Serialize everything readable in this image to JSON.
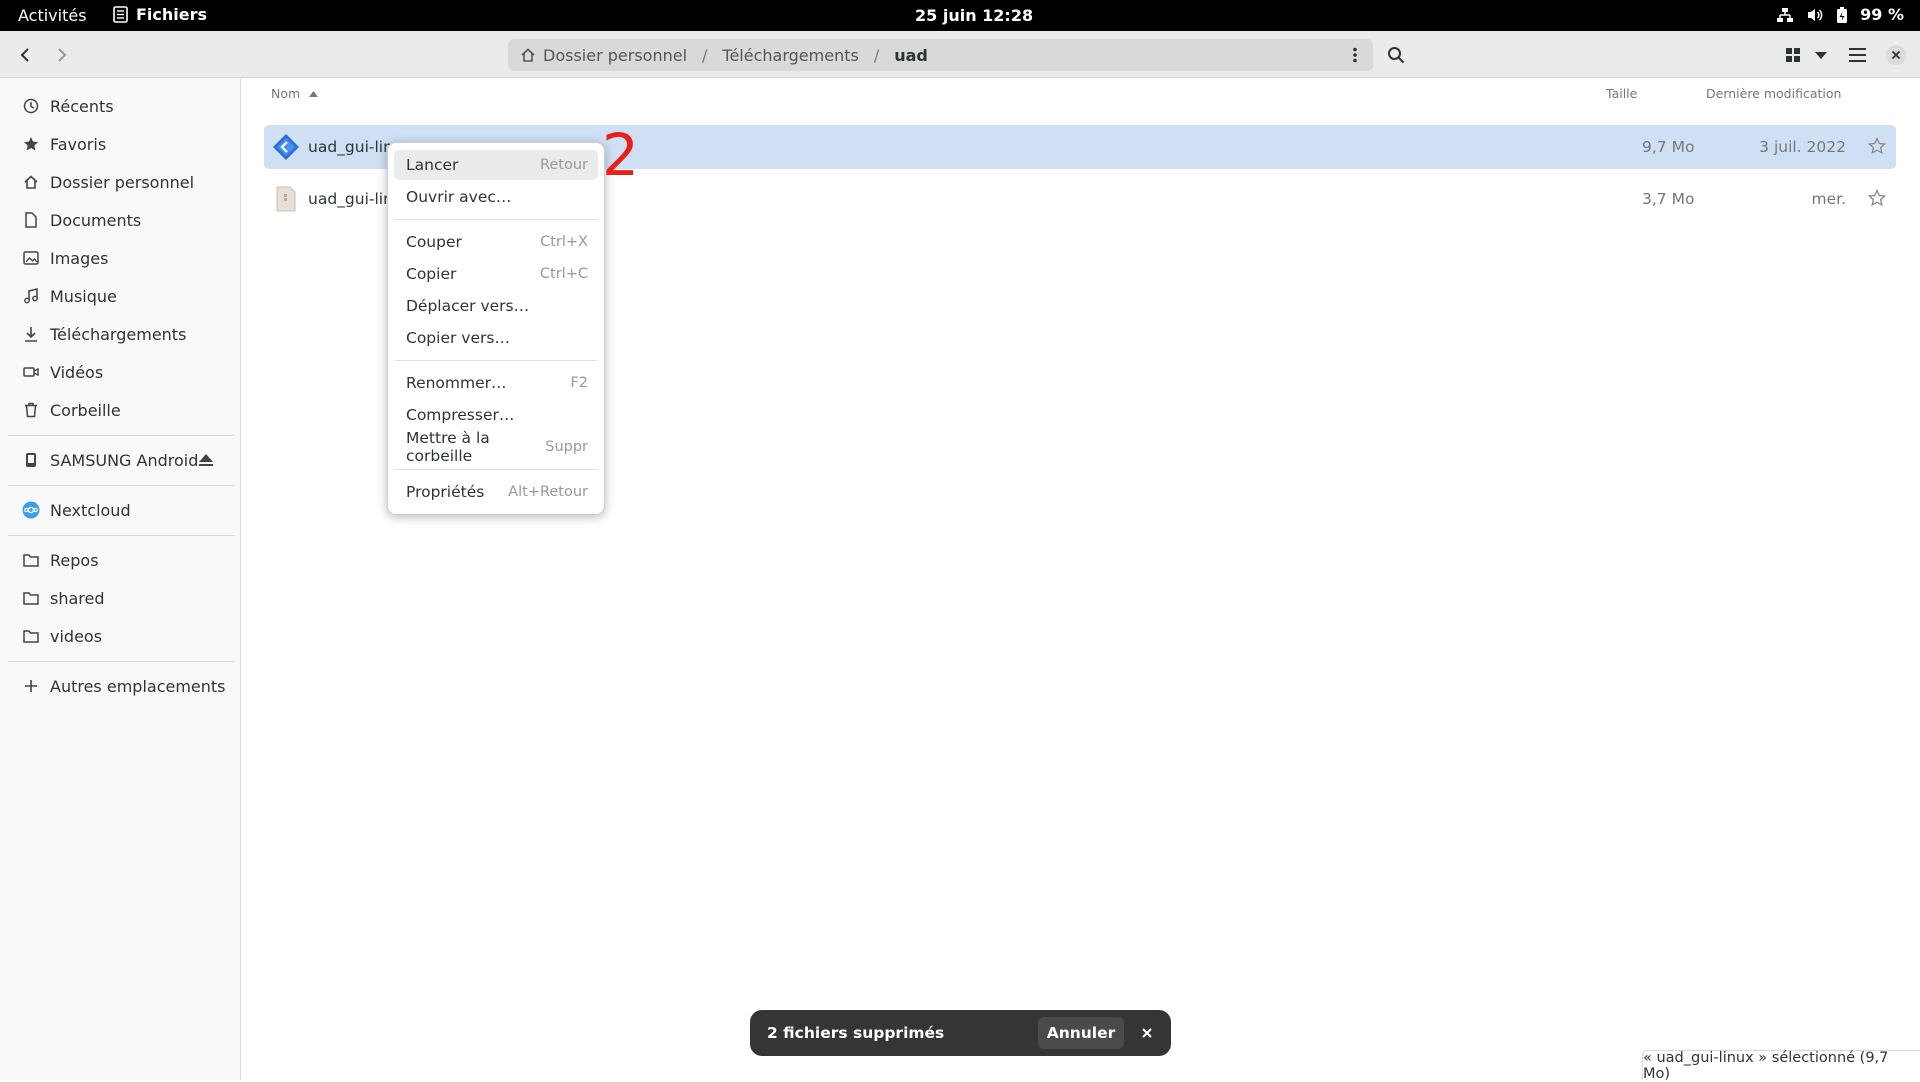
{
  "topbar": {
    "activities": "Activités",
    "app_name": "Fichiers",
    "clock": "25 juin  12:28",
    "battery": "99 %"
  },
  "header": {
    "path": [
      "Dossier personnel",
      "Téléchargements",
      "uad"
    ]
  },
  "sidebar": {
    "places": [
      {
        "label": "Récents",
        "icon": "clock-icon"
      },
      {
        "label": "Favoris",
        "icon": "star-icon"
      },
      {
        "label": "Dossier personnel",
        "icon": "home-icon"
      },
      {
        "label": "Documents",
        "icon": "document-icon"
      },
      {
        "label": "Images",
        "icon": "image-icon"
      },
      {
        "label": "Musique",
        "icon": "music-icon"
      },
      {
        "label": "Téléchargements",
        "icon": "download-icon"
      },
      {
        "label": "Vidéos",
        "icon": "video-icon"
      },
      {
        "label": "Corbeille",
        "icon": "trash-icon"
      }
    ],
    "devices": [
      {
        "label": "SAMSUNG Android",
        "icon": "phone-icon"
      }
    ],
    "network": [
      {
        "label": "Nextcloud",
        "icon": "nextcloud-icon"
      }
    ],
    "bookmarks": [
      {
        "label": "Repos",
        "icon": "folder-icon"
      },
      {
        "label": "shared",
        "icon": "folder-icon"
      },
      {
        "label": "videos",
        "icon": "folder-icon"
      }
    ],
    "other": "Autres emplacements"
  },
  "columns": {
    "name": "Nom",
    "size": "Taille",
    "modified": "Dernière modification"
  },
  "files": [
    {
      "name": "uad_gui-linux",
      "size": "9,7 Mo",
      "modified": "3 juil. 2022",
      "selected": true
    },
    {
      "name": "uad_gui-linu",
      "size": "3,7 Mo",
      "modified": "mer.",
      "selected": false
    }
  ],
  "context_menu": {
    "groups": [
      [
        {
          "label": "Lancer",
          "accel": "Retour"
        },
        {
          "label": "Ouvrir avec…",
          "accel": ""
        }
      ],
      [
        {
          "label": "Couper",
          "accel": "Ctrl+X"
        },
        {
          "label": "Copier",
          "accel": "Ctrl+C"
        },
        {
          "label": "Déplacer vers…",
          "accel": ""
        },
        {
          "label": "Copier vers…",
          "accel": ""
        }
      ],
      [
        {
          "label": "Renommer…",
          "accel": "F2"
        },
        {
          "label": "Compresser…",
          "accel": ""
        },
        {
          "label": "Mettre à la corbeille",
          "accel": "Suppr"
        }
      ],
      [
        {
          "label": "Propriétés",
          "accel": "Alt+Retour"
        }
      ]
    ]
  },
  "annotation": "2",
  "toast": {
    "message": "2 fichiers supprimés",
    "undo": "Annuler"
  },
  "status": "« uad_gui-linux » sélectionné (9,7 Mo)"
}
